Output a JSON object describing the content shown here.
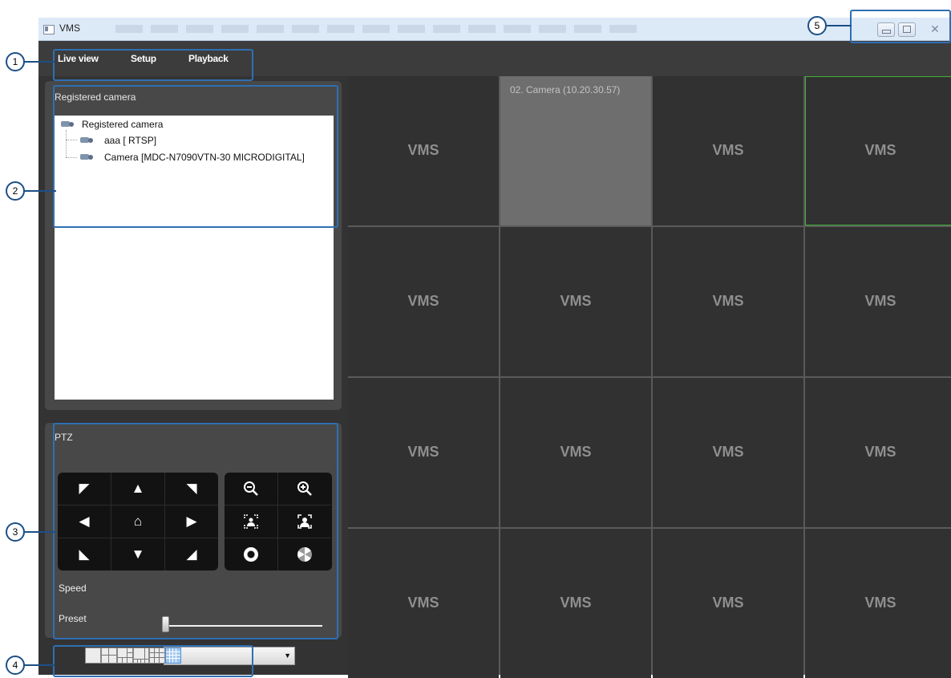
{
  "window": {
    "title": "VMS",
    "buttons": {
      "minimize": "minimize",
      "maximize": "maximize",
      "close": "close"
    }
  },
  "menu": {
    "items": [
      "Live view",
      "Setup",
      "Playback"
    ]
  },
  "registered_panel": {
    "title": "Registered camera",
    "tree": {
      "root": "Registered camera",
      "children": [
        "aaa [ RTSP]",
        "Camera [MDC-N7090VTN-30 MICRODIGITAL]"
      ]
    }
  },
  "ptz": {
    "title": "PTZ",
    "speed_label": "Speed",
    "preset_label": "Preset",
    "speed_value": 0,
    "preset_value": ""
  },
  "layouts": {
    "active_index": 5,
    "options": [
      "1",
      "4",
      "6",
      "8",
      "9",
      "16"
    ]
  },
  "video_grid": {
    "cells": [
      {
        "label": "VMS",
        "caption": ""
      },
      {
        "label": "",
        "caption": "02. Camera (10.20.30.57)"
      },
      {
        "label": "VMS",
        "caption": ""
      },
      {
        "label": "VMS",
        "caption": ""
      },
      {
        "label": "VMS",
        "caption": ""
      },
      {
        "label": "VMS",
        "caption": ""
      },
      {
        "label": "VMS",
        "caption": ""
      },
      {
        "label": "VMS",
        "caption": ""
      },
      {
        "label": "VMS",
        "caption": ""
      },
      {
        "label": "VMS",
        "caption": ""
      },
      {
        "label": "VMS",
        "caption": ""
      },
      {
        "label": "VMS",
        "caption": ""
      },
      {
        "label": "VMS",
        "caption": ""
      },
      {
        "label": "VMS",
        "caption": ""
      },
      {
        "label": "VMS",
        "caption": ""
      },
      {
        "label": "VMS",
        "caption": ""
      }
    ],
    "selected_index": 1,
    "active_index": 3
  },
  "callouts": [
    "1",
    "2",
    "3",
    "4",
    "5"
  ],
  "colors": {
    "background": "#3c3c3c",
    "cell": "#313131",
    "active_border": "#3fb23a",
    "callout": "#2f6fb3"
  }
}
